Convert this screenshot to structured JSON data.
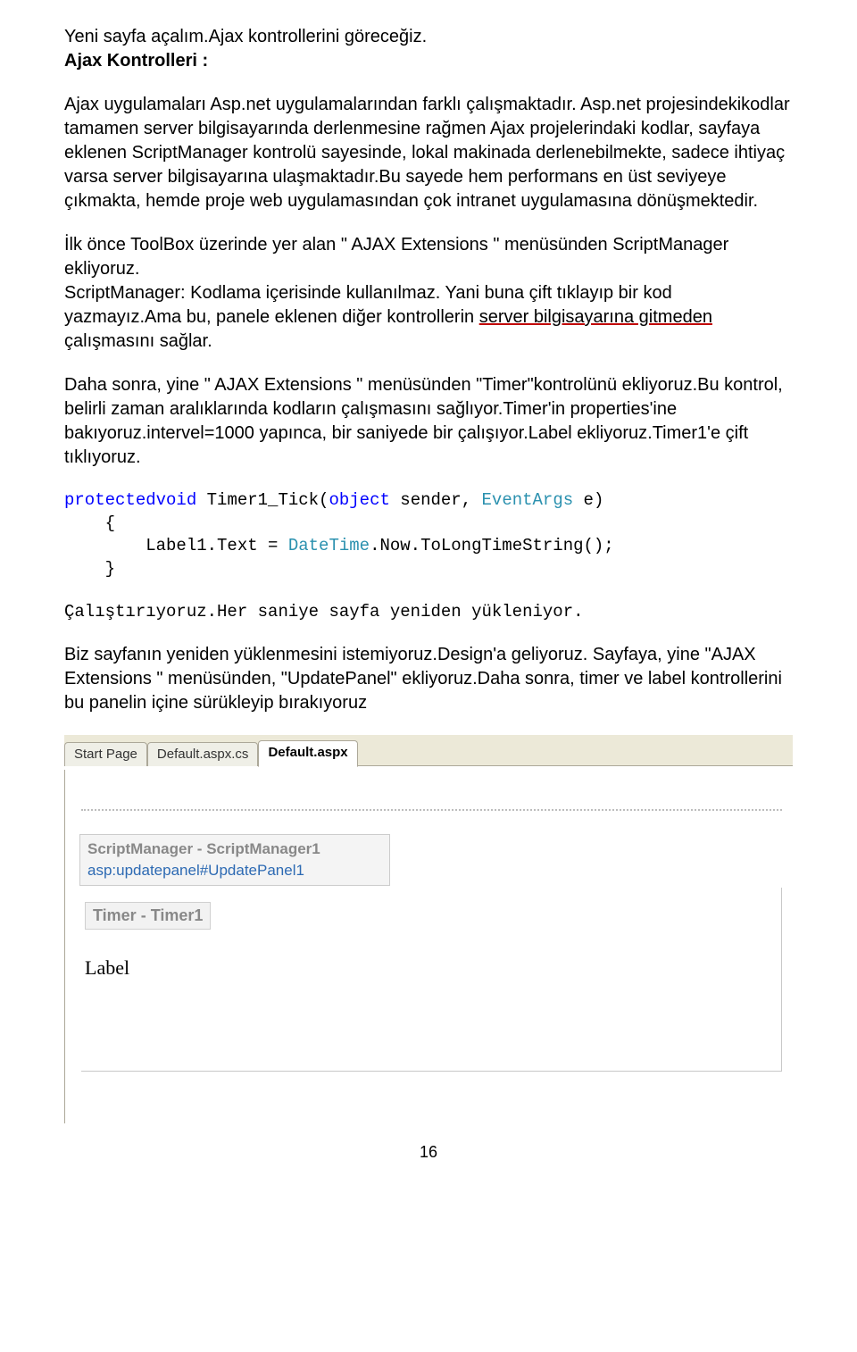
{
  "para1_a": "Yeni sayfa açalım.Ajax kontrollerini göreceğiz.",
  "para1_b": "Ajax Kontrolleri :",
  "para2": "Ajax uygulamaları Asp.net uygulamalarından farklı çalışmaktadır. Asp.net projesindekikodlar tamamen server bilgisayarında derlenmesine rağmen Ajax projelerindaki kodlar, sayfaya eklenen ScriptManager kontrolü sayesinde, lokal makinada derlenebilmekte, sadece ihtiyaç varsa server bilgisayarına ulaşmaktadır.Bu sayede hem performans en üst seviyeye çıkmakta, hemde proje web uygulamasından çok intranet uygulamasına dönüşmektedir.",
  "para3_a": "İlk önce ToolBox üzerinde yer alan \" AJAX Extensions \" menüsünden ScriptManager ekliyoruz.",
  "para3_b": "ScriptManager: Kodlama içerisinde kullanılmaz. Yani buna çift tıklayıp bir kod yazmayız.Ama bu, panele eklenen diğer kontrollerin ",
  "para3_c": "server bilgisayarına gitmeden",
  "para3_d": " çalışmasını sağlar.",
  "para4": "Daha sonra, yine \" AJAX Extensions \" menüsünden \"Timer\"kontrolünü ekliyoruz.Bu kontrol, belirli zaman aralıklarında kodların çalışmasını sağlıyor.Timer'in properties'ine bakıyoruz.intervel=1000 yapınca, bir saniyede bir çalışıyor.Label ekliyoruz.Timer1'e çift tıklıyoruz.",
  "code": {
    "l1_a": "protectedvoid",
    "l1_b": " Timer1_Tick(",
    "l1_c": "object",
    "l1_d": " sender, ",
    "l1_e": "EventArgs",
    "l1_f": " e)",
    "l2": "    {",
    "l3_a": "        Label1.Text = ",
    "l3_b": "DateTime",
    "l3_c": ".Now.ToLongTimeString();",
    "l4": "    }"
  },
  "para5": "Çalıştırıyoruz.Her saniye sayfa yeniden yükleniyor.",
  "para6": "Biz sayfanın yeniden yüklenmesini istemiyoruz.Design'a geliyoruz. Sayfaya, yine \"AJAX Extensions \" menüsünden, \"UpdatePanel\" ekliyoruz.Daha sonra, timer ve label kontrollerini bu panelin içine sürükleyip bırakıyoruz",
  "vs": {
    "tab1": "Start Page",
    "tab2": "Default.aspx.cs",
    "tab3": "Default.aspx",
    "sm_line1": "ScriptManager - ScriptManager1",
    "sm_line2": "asp:updatepanel#UpdatePanel1",
    "timer": "Timer - Timer1",
    "label": "Label"
  },
  "pagenum": "16"
}
